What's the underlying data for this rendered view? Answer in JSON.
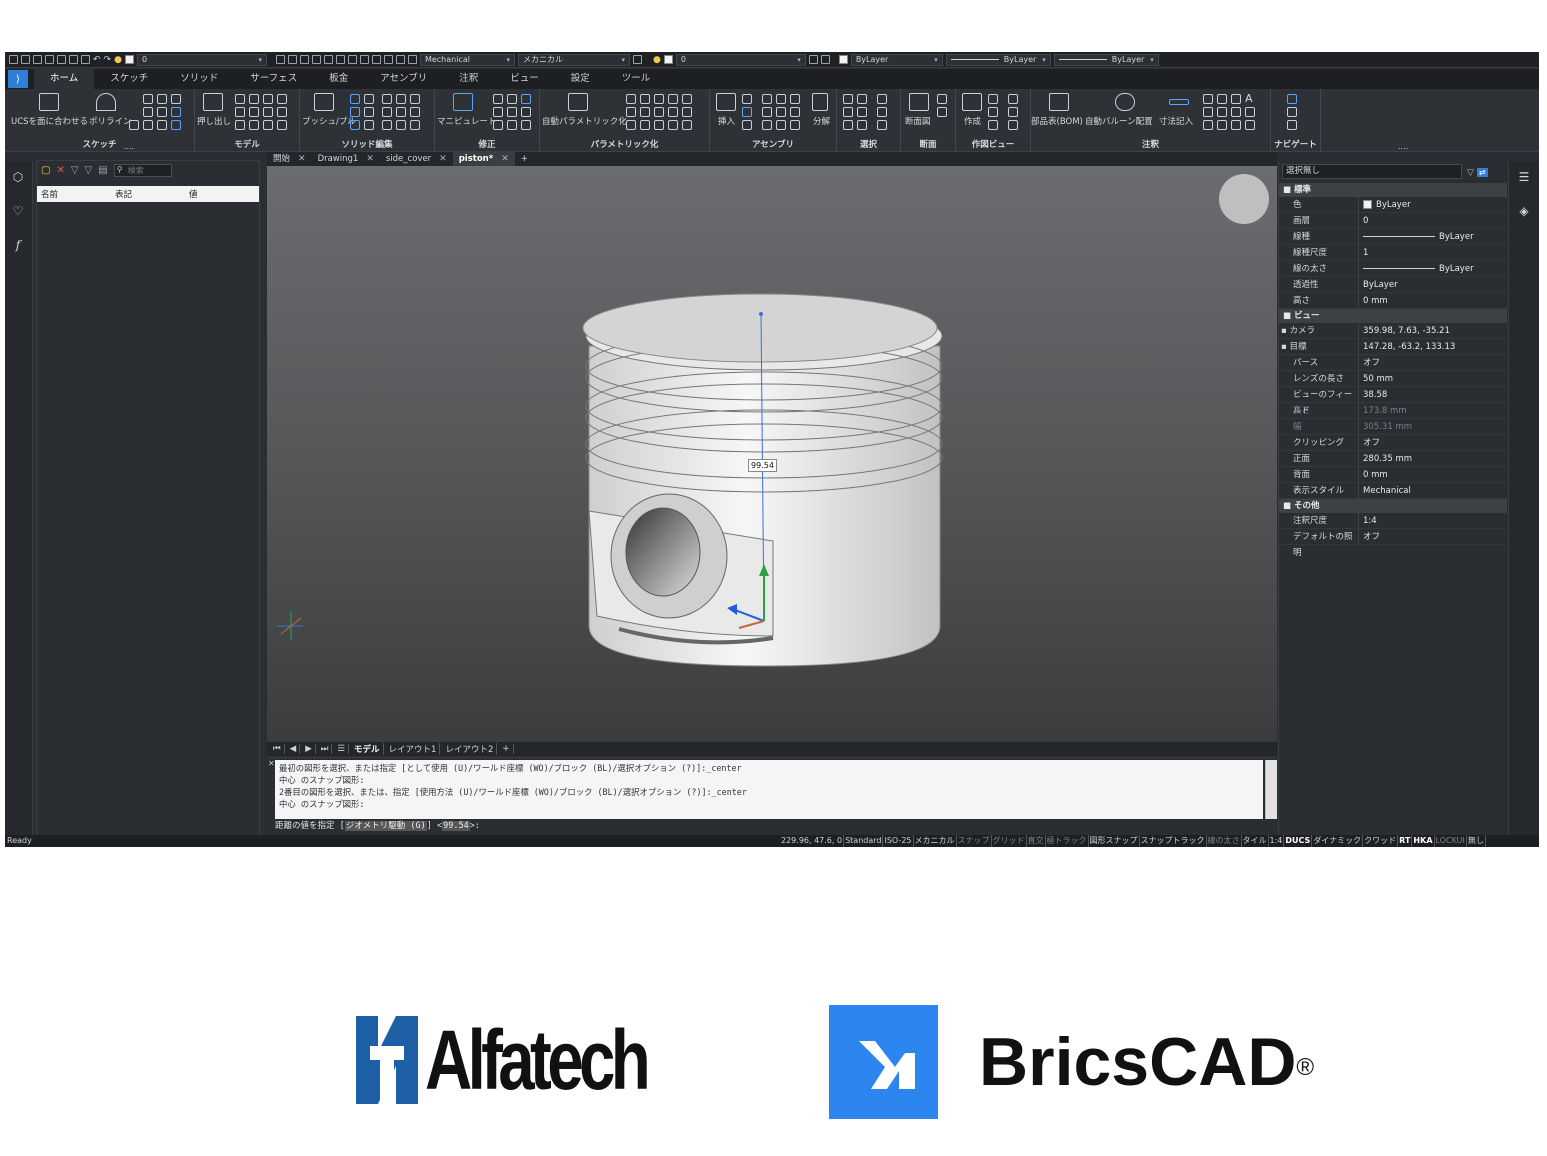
{
  "quick_access": {
    "layer_value": "0",
    "view_style": "Mechanical",
    "workspace": "メカニカル",
    "layer_value2": "0",
    "color": "ByLayer",
    "linetype": "ByLayer",
    "lineweight": "ByLayer"
  },
  "menu_tabs": [
    "ホーム",
    "スケッチ",
    "ソリッド",
    "サーフェス",
    "板金",
    "アセンブリ",
    "注釈",
    "ビュー",
    "設定",
    "ツール"
  ],
  "ribbon": {
    "sketch": {
      "label": "スケッチ",
      "btn1": "UCSを面に合わせる",
      "btn2": "ポリライン"
    },
    "model": {
      "label": "モデル",
      "btn1": "押し出し"
    },
    "solid_edit": {
      "label": "ソリッド編集",
      "btn1": "プッシュ/プル"
    },
    "modify": {
      "label": "修正",
      "btn1": "マニピュレート"
    },
    "parametric": {
      "label": "パラメトリック化",
      "btn1": "自動パラメトリック化"
    },
    "assembly": {
      "label": "アセンブリ",
      "btn1": "挿入",
      "btn2": "分解"
    },
    "select": {
      "label": "選択"
    },
    "section": {
      "label": "断面",
      "btn1": "断面図"
    },
    "drawing_view": {
      "label": "作図ビュー",
      "btn1": "作成"
    },
    "annotation": {
      "label": "注釈",
      "btn1": "部品表(BOM)",
      "btn2": "自動バルーン配置",
      "btn3": "寸法記入"
    },
    "navigate": {
      "label": "ナビゲート"
    },
    "more": "...."
  },
  "doc_tabs": [
    {
      "label": "開始",
      "active": false
    },
    {
      "label": "Drawing1",
      "active": false
    },
    {
      "label": "side_cover",
      "active": false
    },
    {
      "label": "piston*",
      "active": true
    }
  ],
  "left_panel": {
    "search_placeholder": "検索",
    "col_name": "名前",
    "col_expr": "表記",
    "col_value": "値"
  },
  "viewport": {
    "dimension_value": "99.54"
  },
  "layout_tabs": [
    "モデル",
    "レイアウト1",
    "レイアウト2",
    "+"
  ],
  "command": {
    "history": [
      "最初の図形を選択、または指定 [として使用 (U)/ワールド座標 (WO)/ブロック (BL)/選択オプション (?)]:_center",
      "中心 のスナップ図形:",
      "2番目の図形を選択、または、指定 [使用方法 (U)/ワールド座標 (WO)/ブロック (BL)/選択オプション (?)]:_center",
      "中心 のスナップ図形:"
    ],
    "prompt_prefix": "距離の値を指定 [",
    "prompt_option": "ジオメトリ駆動 (G)",
    "prompt_mid": "] <",
    "prompt_default": "99.54",
    "prompt_suffix": ">:"
  },
  "properties": {
    "selection": "選択無し",
    "groups": [
      {
        "title": "標準",
        "rows": [
          {
            "k": "色",
            "v": "ByLayer",
            "dim": false
          },
          {
            "k": "画層",
            "v": "0",
            "dim": false
          },
          {
            "k": "線種",
            "v": "ByLayer",
            "dim": false
          },
          {
            "k": "線種尺度",
            "v": "1",
            "dim": false
          },
          {
            "k": "線の太さ",
            "v": "ByLayer",
            "dim": false
          },
          {
            "k": "透過性",
            "v": "ByLayer",
            "dim": false
          },
          {
            "k": "高さ",
            "v": "0 mm",
            "dim": false
          }
        ]
      },
      {
        "title": "ビュー",
        "rows": [
          {
            "k": "カメラ",
            "v": "359.98, 7.63, -35.21",
            "dim": false
          },
          {
            "k": "目標",
            "v": "147.28, -63.2, 133.13",
            "dim": false
          },
          {
            "k": "パース",
            "v": "オフ",
            "dim": false
          },
          {
            "k": "レンズの長さ",
            "v": "50 mm",
            "dim": false
          },
          {
            "k": "ビューのフィールド",
            "v": "38.58",
            "dim": false
          },
          {
            "k": "高さ",
            "v": "173.8 mm",
            "dim": true
          },
          {
            "k": "幅",
            "v": "305.31 mm",
            "dim": true
          },
          {
            "k": "クリッピング",
            "v": "オフ",
            "dim": false
          },
          {
            "k": "正面",
            "v": "280.35 mm",
            "dim": false
          },
          {
            "k": "背面",
            "v": "0 mm",
            "dim": false
          },
          {
            "k": "表示スタイル",
            "v": "Mechanical",
            "dim": false
          }
        ]
      },
      {
        "title": "その他",
        "rows": [
          {
            "k": "注釈尺度",
            "v": "1:4",
            "dim": false
          },
          {
            "k": "デフォルトの照明",
            "v": "オフ",
            "dim": false
          }
        ]
      }
    ]
  },
  "status_bar": {
    "ready": "Ready",
    "items": [
      {
        "t": "229.96, 47.6, 0",
        "s": "norm"
      },
      {
        "t": "Standard",
        "s": "norm"
      },
      {
        "t": "ISO-25",
        "s": "norm"
      },
      {
        "t": "メカニカル",
        "s": "norm"
      },
      {
        "t": "スナップ",
        "s": "off"
      },
      {
        "t": "グリッド",
        "s": "off"
      },
      {
        "t": "直交",
        "s": "off"
      },
      {
        "t": "極トラック",
        "s": "off"
      },
      {
        "t": "図形スナップ",
        "s": "norm"
      },
      {
        "t": "スナップトラック",
        "s": "norm"
      },
      {
        "t": "線の太さ",
        "s": "off"
      },
      {
        "t": "タイル",
        "s": "norm"
      },
      {
        "t": "1:4",
        "s": "norm"
      },
      {
        "t": "DUCS",
        "s": "on"
      },
      {
        "t": "ダイナミック",
        "s": "norm"
      },
      {
        "t": "クワッド",
        "s": "norm"
      },
      {
        "t": "RT",
        "s": "on"
      },
      {
        "t": "HKA",
        "s": "on"
      },
      {
        "t": "LOCKUI",
        "s": "off"
      },
      {
        "t": "無し",
        "s": "norm"
      }
    ]
  },
  "brands": {
    "alfatech": "Alfatech",
    "bricscad": "BricsCAD",
    "registered": "®",
    "alfatech_color": "#1f5fa6",
    "bricscad_color": "#2d86ef"
  }
}
